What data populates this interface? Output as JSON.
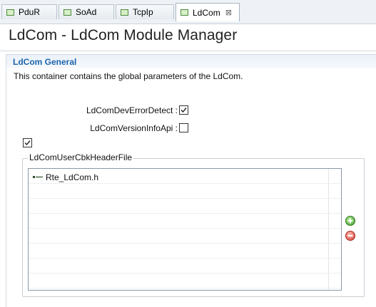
{
  "tabs": [
    {
      "label": "PduR",
      "active": false
    },
    {
      "label": "SoAd",
      "active": false
    },
    {
      "label": "TcpIp",
      "active": false
    },
    {
      "label": "LdCom",
      "active": true,
      "close": "⊠"
    }
  ],
  "page": {
    "title": "LdCom - LdCom Module Manager"
  },
  "section": {
    "title": "LdCom General",
    "description": "This container contains the global parameters of the LdCom."
  },
  "fields": {
    "dev_error_detect": {
      "label": "LdComDevErrorDetect :",
      "checked": true
    },
    "version_info_api": {
      "label": "LdComVersionInfoApi :",
      "checked": false
    },
    "standalone_checkbox": {
      "checked": true
    }
  },
  "group": {
    "label": "LdComUserCbkHeaderFile",
    "items": [
      "Rte_LdCom.h"
    ]
  },
  "colors": {
    "section_title": "#1c64ad",
    "add_button": "#3e9a2a",
    "remove_button": "#d33a2a"
  },
  "icons": {
    "tab_icon": "module-file-icon",
    "row_icon": "list-item-icon",
    "add": "add-plus-icon",
    "remove": "remove-minus-icon"
  }
}
